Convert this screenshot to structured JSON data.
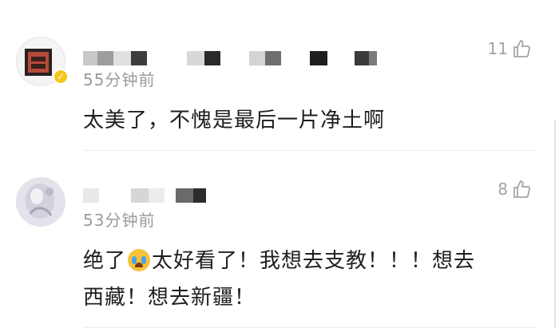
{
  "comments": [
    {
      "time": "55分钟前",
      "likes": "11",
      "text": "太美了，不愧是最后一片净土啊",
      "verified_mark": "✓"
    },
    {
      "time": "53分钟前",
      "likes": "8",
      "text_before_emoji": "绝了",
      "text_after_emoji": "太好看了！我想去支教！！！想去",
      "text_line2": "西藏！想去新疆！",
      "emoji_icon": "crying-face-icon"
    }
  ],
  "colors": {
    "time_text": "#9a9a9a",
    "like_text": "#a3a3a3",
    "badge": "#f5c518"
  }
}
